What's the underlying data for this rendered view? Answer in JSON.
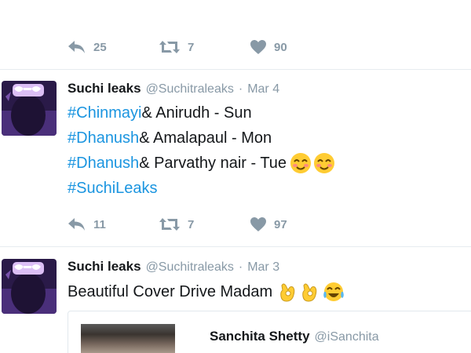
{
  "top_tweet": {
    "reply_count": "25",
    "retweet_count": "7",
    "like_count": "90"
  },
  "tweets": [
    {
      "name": "Suchi leaks",
      "handle": "@Suchitraleaks",
      "separator": "·",
      "date": "Mar 4",
      "lines": [
        {
          "hashtag": "#Chinmayi",
          "text": " & Anirudh - Sun"
        },
        {
          "hashtag": "#Dhanush",
          "text": " & Amalapaul - Mon"
        },
        {
          "hashtag": "#Dhanush",
          "text": " & Parvathy nair - Tue"
        },
        {
          "hashtag": "#SuchiLeaks",
          "text": ""
        }
      ],
      "emojis": [
        "smiling-face-icon",
        "smiling-face-icon"
      ],
      "reply_count": "11",
      "retweet_count": "7",
      "like_count": "97"
    },
    {
      "name": "Suchi leaks",
      "handle": "@Suchitraleaks",
      "separator": "·",
      "date": "Mar 3",
      "text": "Beautiful Cover Drive Madam",
      "emojis": [
        "ok-hand-icon",
        "ok-hand-icon",
        "tears-of-joy-icon"
      ],
      "quote": {
        "name": "Sanchita Shetty",
        "handle": "@iSanchita"
      }
    }
  ],
  "colors": {
    "hashtag": "#1b95e0",
    "muted": "#8899a6",
    "divider": "#e6ecf0",
    "avatar_bg": "#3b1f5e"
  }
}
